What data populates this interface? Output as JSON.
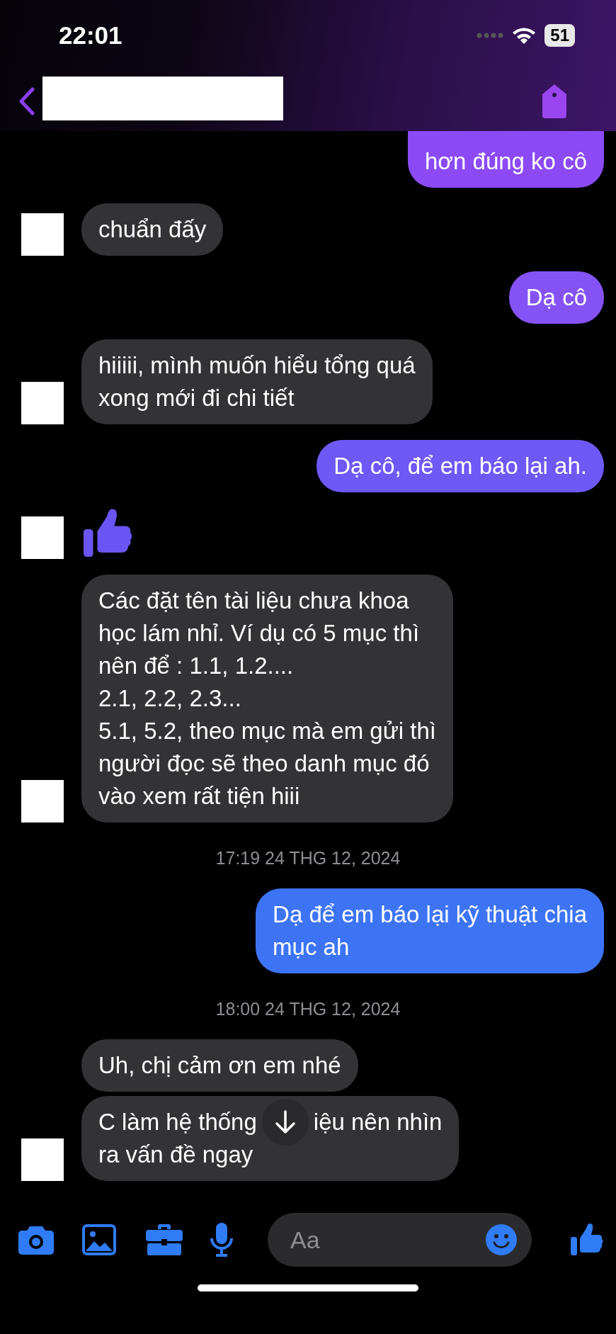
{
  "status_bar": {
    "time": "22:01",
    "battery": "51"
  },
  "header": {
    "name_redacted": true
  },
  "messages": [
    {
      "kind": "outgoing",
      "clipped_top": true,
      "color": "#8b4af6",
      "bubbles": [
        {
          "text": "hơn đúng ko cô"
        }
      ]
    },
    {
      "kind": "incoming",
      "avatar": true,
      "bubbles": [
        {
          "text": "chuẩn đấy"
        }
      ]
    },
    {
      "kind": "outgoing",
      "color": "#8552f6",
      "bubbles": [
        {
          "text": "Dạ cô"
        }
      ]
    },
    {
      "kind": "incoming",
      "avatar": true,
      "bubbles": [
        {
          "text": "hiiiii, mình muốn hiểu tổng quá\nxong mới đi chi tiết"
        }
      ]
    },
    {
      "kind": "outgoing",
      "color": "#6e58f6",
      "bubbles": [
        {
          "text": "Dạ cô, để em báo lại ah."
        }
      ]
    },
    {
      "kind": "like",
      "avatar": true,
      "color": "#6a55f4"
    },
    {
      "kind": "incoming",
      "avatar": true,
      "bubbles": [
        {
          "text": "Các đặt tên tài liệu chưa khoa\nhọc lám nhỉ. Ví dụ có 5 mục thì\nnên để : 1.1, 1.2....\n2.1, 2.2, 2.3...\n5.1, 5.2, theo mục mà em gửi thì\nngười đọc sẽ theo danh mục đó\nvào xem rất tiện hiii"
        }
      ]
    },
    {
      "kind": "timestamp",
      "text": "17:19 24 THG 12, 2024"
    },
    {
      "kind": "outgoing",
      "color": "#3d74f6",
      "bubbles": [
        {
          "text": "Dạ để em báo lại kỹ thuật chia\nmục ah"
        }
      ]
    },
    {
      "kind": "timestamp",
      "text": "18:00 24 THG 12, 2024"
    },
    {
      "kind": "incoming",
      "avatar": true,
      "bubbles": [
        {
          "text": "Uh, chị cảm ơn em nhé"
        },
        {
          "lines": [
            [
              "C làm hệ thống",
              "iệu nên nhìn"
            ],
            [
              "ra vấn đề ngay"
            ]
          ]
        }
      ]
    }
  ],
  "scroll_down_button": true,
  "composer": {
    "placeholder": "Aa"
  }
}
